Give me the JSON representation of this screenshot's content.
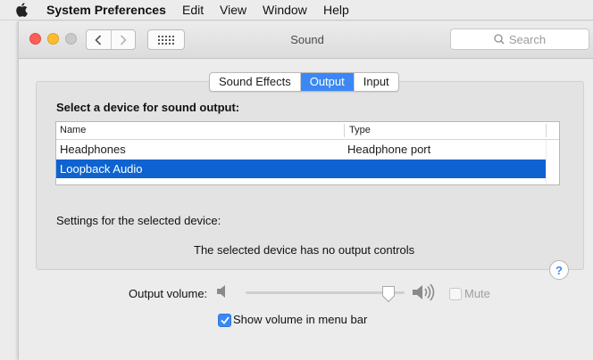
{
  "menubar": {
    "app_name": "System Preferences",
    "items": [
      "Edit",
      "View",
      "Window",
      "Help"
    ]
  },
  "window": {
    "title": "Sound",
    "search_placeholder": "Search"
  },
  "tabs": [
    {
      "label": "Sound Effects",
      "selected": false
    },
    {
      "label": "Output",
      "selected": true
    },
    {
      "label": "Input",
      "selected": false
    }
  ],
  "panel": {
    "heading": "Select a device for sound output:",
    "table": {
      "columns": [
        "Name",
        "Type"
      ],
      "rows": [
        {
          "name": "Headphones",
          "type": "Headphone port",
          "selected": false
        },
        {
          "name": "Loopback Audio",
          "type": "",
          "selected": true
        }
      ]
    },
    "settings_label": "Settings for the selected device:",
    "no_controls_message": "The selected device has no output controls",
    "help_label": "?"
  },
  "output_volume": {
    "label": "Output volume:",
    "level": 0.9,
    "mute_label": "Mute",
    "mute_checked": false,
    "mute_enabled": false
  },
  "show_volume": {
    "label": "Show volume in menu bar",
    "checked": true
  },
  "colors": {
    "accent": "#3b88f5",
    "selection": "#0e63d0",
    "close": "#fd5f57",
    "minimize": "#fdbb2e"
  }
}
